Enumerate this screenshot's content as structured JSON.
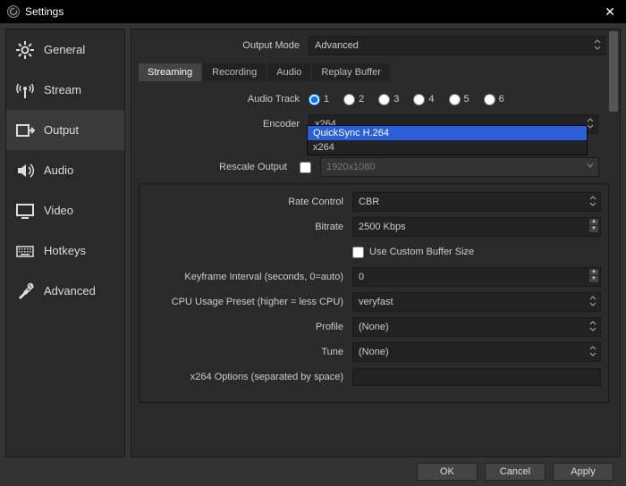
{
  "window": {
    "title": "Settings"
  },
  "sidebar": {
    "items": [
      {
        "label": "General"
      },
      {
        "label": "Stream"
      },
      {
        "label": "Output"
      },
      {
        "label": "Audio"
      },
      {
        "label": "Video"
      },
      {
        "label": "Hotkeys"
      },
      {
        "label": "Advanced"
      }
    ]
  },
  "output_mode": {
    "label": "Output Mode",
    "value": "Advanced"
  },
  "tabs": [
    {
      "label": "Streaming"
    },
    {
      "label": "Recording"
    },
    {
      "label": "Audio"
    },
    {
      "label": "Replay Buffer"
    }
  ],
  "audio_track": {
    "label": "Audio Track",
    "options": [
      "1",
      "2",
      "3",
      "4",
      "5",
      "6"
    ],
    "selected": "1"
  },
  "encoder": {
    "label": "Encoder",
    "value": "x264",
    "dropdown_open": true,
    "options": [
      "QuickSync H.264",
      "x264"
    ],
    "highlighted": "QuickSync H.264"
  },
  "rescale": {
    "label": "Rescale Output",
    "checked": false,
    "value": "1920x1080"
  },
  "group": {
    "rate_control": {
      "label": "Rate Control",
      "value": "CBR"
    },
    "bitrate": {
      "label": "Bitrate",
      "value": "2500 Kbps"
    },
    "custom_buffer": {
      "label": "Use Custom Buffer Size",
      "checked": false
    },
    "keyframe": {
      "label": "Keyframe Interval (seconds, 0=auto)",
      "value": "0"
    },
    "cpu_preset": {
      "label": "CPU Usage Preset (higher = less CPU)",
      "value": "veryfast"
    },
    "profile": {
      "label": "Profile",
      "value": "(None)"
    },
    "tune": {
      "label": "Tune",
      "value": "(None)"
    },
    "x264_opts": {
      "label": "x264 Options (separated by space)",
      "value": ""
    }
  },
  "buttons": {
    "ok": "OK",
    "cancel": "Cancel",
    "apply": "Apply"
  }
}
